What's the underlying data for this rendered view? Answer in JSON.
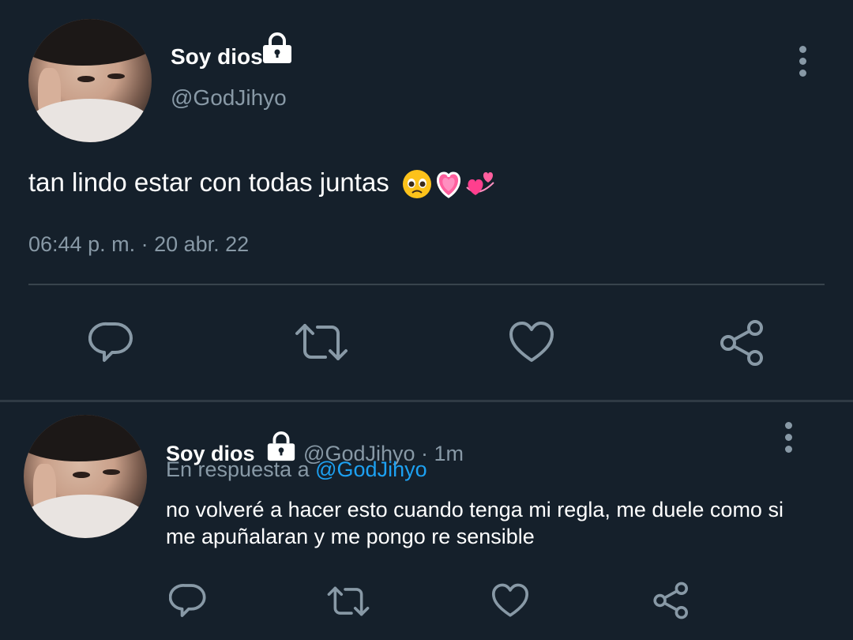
{
  "main_tweet": {
    "display_name": "Soy dios",
    "handle": "@GodJihyo",
    "text": "tan lindo estar con todas juntas",
    "emojis": [
      "pleading-face-emoji",
      "growing-heart-emoji",
      "revolving-hearts-emoji"
    ],
    "timestamp": "06:44 p. m. · 20 abr. 22",
    "actions": [
      "reply-icon",
      "retweet-icon",
      "like-icon",
      "share-icon"
    ]
  },
  "reply_tweet": {
    "display_name": "Soy dios",
    "handle": "@GodJihyo",
    "separator": " · ",
    "time": "1m",
    "in_reply_to_prefix": "En respuesta a ",
    "in_reply_to_handle": "@GodJihyo",
    "text": "no volveré a hacer esto cuando tenga mi regla, me duele como si me apuñalaran y me pongo re sensible",
    "actions": [
      "reply-icon",
      "retweet-icon",
      "like-icon",
      "share-icon"
    ]
  },
  "colors": {
    "background": "#15202b",
    "secondary_text": "#8899a6",
    "mention": "#1da1f2",
    "divider": "#38444d"
  }
}
